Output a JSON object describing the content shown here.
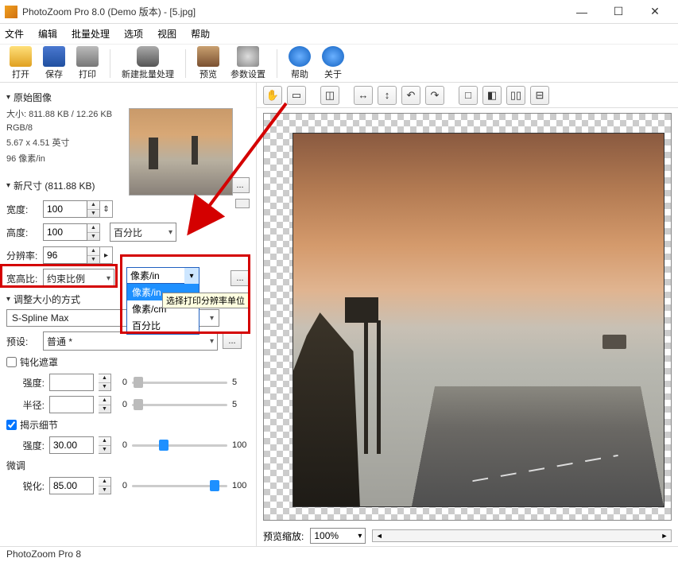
{
  "title": "PhotoZoom Pro 8.0 (Demo 版本) - [5.jpg]",
  "menu": [
    "文件",
    "编辑",
    "批量处理",
    "选项",
    "视图",
    "帮助"
  ],
  "toolbar": {
    "open": "打开",
    "save": "保存",
    "print": "打印",
    "batch": "新建批量处理",
    "preview": "预览",
    "params": "参数设置",
    "help": "帮助",
    "about": "关于"
  },
  "sections": {
    "original": "原始图像",
    "newsize": "新尺寸 (811.88 KB)",
    "resize_method": "调整大小的方式",
    "microtune": "微调"
  },
  "info": {
    "size": "大小: 811.88 KB / 12.26 KB",
    "rgb": "RGB/8",
    "dims": "5.67 x 4.51 英寸",
    "dpi": "96 像素/in"
  },
  "labels": {
    "width": "宽度:",
    "height": "高度:",
    "resolution": "分辨率:",
    "aspect": "宽高比:",
    "preset": "预设:",
    "strength": "强度:",
    "radius": "半径:",
    "sharpen": "锐化:"
  },
  "values": {
    "width": "100",
    "height": "100",
    "resolution": "96",
    "unit_percent": "百分比",
    "dd_selected": "像素/in",
    "dd_tooltip": "选择打印分辨率单位",
    "dd_opts": [
      "像素/in",
      "像素/cm",
      "百分比"
    ],
    "aspect": "约束比例",
    "method": "S-Spline Max",
    "preset": "普通 *",
    "unsharp_label": "钝化遮罩",
    "reveal_label": "揭示细节",
    "strength_um": "",
    "radius_um": "",
    "strength_rd": "30.00",
    "sharpen": "85.00",
    "slider_min": "0",
    "slider_max_5": "5",
    "slider_max_100": "100"
  },
  "preview": {
    "zoom_label": "预览缩放:",
    "zoom": "100%"
  },
  "status": "PhotoZoom Pro 8"
}
